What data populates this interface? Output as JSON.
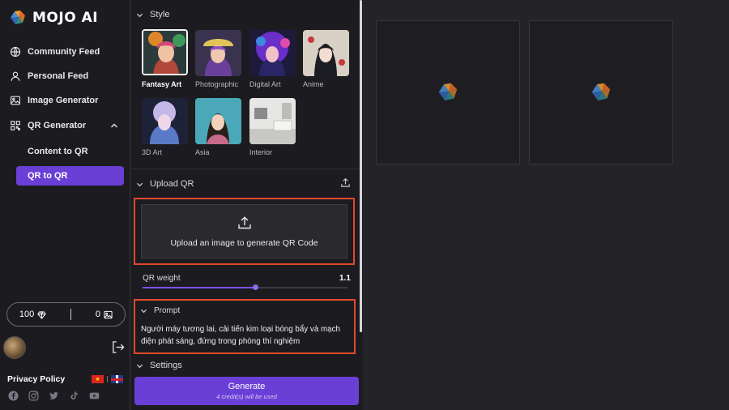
{
  "app": {
    "name": "MOJO AI"
  },
  "sidebar": {
    "items": [
      {
        "label": "Community Feed",
        "icon": "globe-icon"
      },
      {
        "label": "Personal Feed",
        "icon": "user-icon"
      },
      {
        "label": "Image Generator",
        "icon": "image-icon"
      },
      {
        "label": "QR Generator",
        "icon": "qr-icon"
      }
    ],
    "qr_sub": [
      {
        "label": "Content to QR",
        "active": false
      },
      {
        "label": "QR to QR",
        "active": true
      }
    ],
    "credits": {
      "diamonds": "100",
      "images": "0"
    },
    "privacy": "Privacy Policy",
    "socials": [
      "facebook-icon",
      "instagram-icon",
      "twitter-icon",
      "tiktok-icon",
      "youtube-icon"
    ]
  },
  "style": {
    "heading": "Style",
    "options": [
      {
        "label": "Fantasy Art",
        "selected": true
      },
      {
        "label": "Photographic",
        "selected": false
      },
      {
        "label": "Digital Art",
        "selected": false
      },
      {
        "label": "Anime",
        "selected": false
      },
      {
        "label": "3D Art",
        "selected": false
      },
      {
        "label": "Asia",
        "selected": false
      },
      {
        "label": "Interior",
        "selected": false
      }
    ]
  },
  "upload": {
    "heading": "Upload QR",
    "text": "Upload an image to generate QR Code"
  },
  "qr_weight": {
    "label": "QR weight",
    "value": "1.1",
    "fraction": 0.55
  },
  "prompt": {
    "heading": "Prompt",
    "text": "Người máy tương lai, cải tiến kim loại bóng bẩy và mạch điện phát sáng, đứng trong phòng thí nghiệm"
  },
  "settings": {
    "heading": "Settings"
  },
  "generate": {
    "label": "Generate",
    "sub": "4 credit(s) will be used"
  },
  "colors": {
    "accent": "#6a3fd6",
    "highlight": "#e0492e"
  }
}
